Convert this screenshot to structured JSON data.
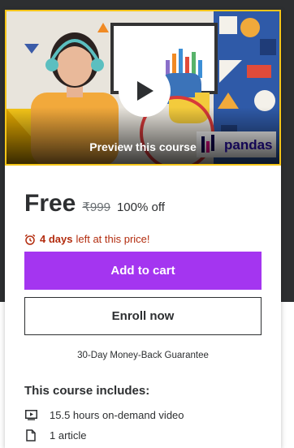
{
  "preview": {
    "label": "Preview this course",
    "logo_text": "pandas"
  },
  "pricing": {
    "current": "Free",
    "original": "₹999",
    "discount": "100% off"
  },
  "timer": {
    "highlight": "4 days",
    "rest": "left at this price!"
  },
  "buttons": {
    "add_to_cart": "Add to cart",
    "enroll_now": "Enroll now"
  },
  "guarantee": "30-Day Money-Back Guarantee",
  "includes": {
    "title": "This course includes:",
    "items": [
      {
        "icon": "video-icon",
        "text": "15.5 hours on-demand video"
      },
      {
        "icon": "file-icon",
        "text": "1 article"
      }
    ]
  },
  "colors": {
    "accent": "#a435f0",
    "timer": "#b32d0f",
    "dark": "#2d2f31"
  }
}
